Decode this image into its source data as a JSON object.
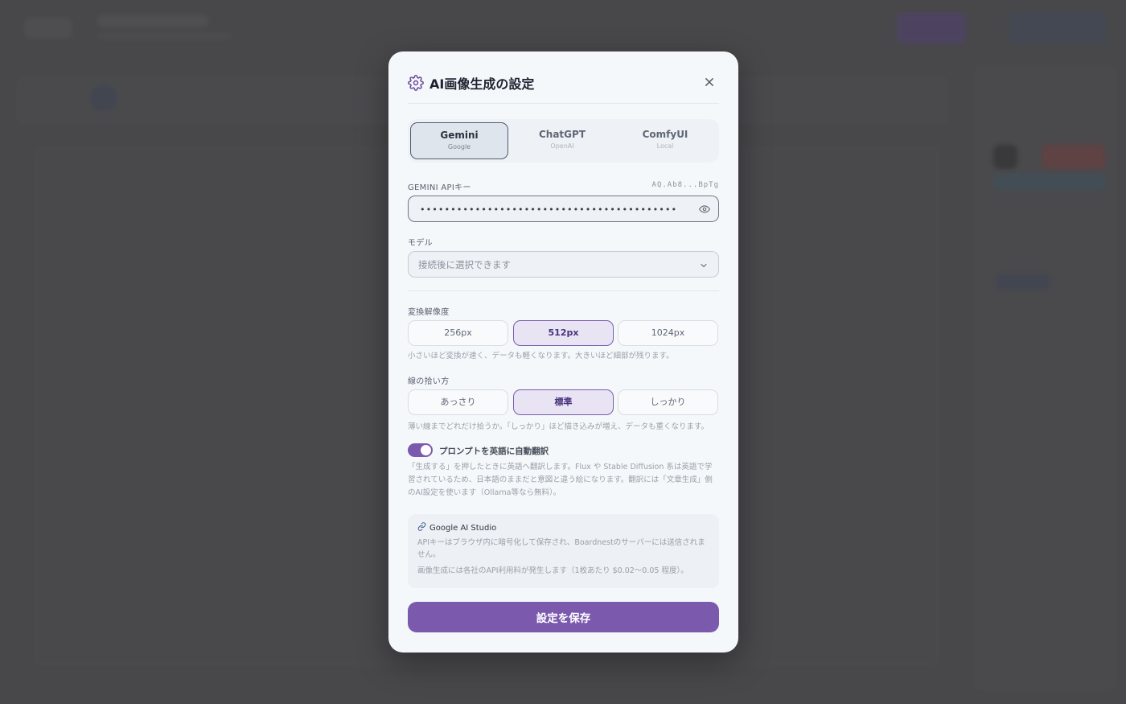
{
  "modal": {
    "title": "AI画像生成の設定",
    "providers": [
      {
        "name": "Gemini",
        "sub": "Google",
        "active": true
      },
      {
        "name": "ChatGPT",
        "sub": "OpenAI",
        "active": false
      },
      {
        "name": "ComfyUI",
        "sub": "Local",
        "active": false
      }
    ],
    "api_key": {
      "label": "GEMINI APIキー",
      "masked_preview": "AQ.Ab8...BpTg",
      "value": "•••••••••••••••••••••••••••••••••••••••••••••"
    },
    "model": {
      "label": "モデル",
      "placeholder": "接続後に選択できます"
    },
    "resolution": {
      "label": "変換解像度",
      "options": [
        "256px",
        "512px",
        "1024px"
      ],
      "selected": "512px",
      "help": "小さいほど変換が速く、データも軽くなります。大きいほど細部が残ります。"
    },
    "line_pickup": {
      "label": "線の拾い方",
      "options": [
        "あっさり",
        "標準",
        "しっかり"
      ],
      "selected": "標準",
      "help": "薄い線までどれだけ拾うか。「しっかり」ほど描き込みが増え、データも重くなります。"
    },
    "translate": {
      "label": "プロンプトを英語に自動翻訳",
      "enabled": true,
      "help": "「生成する」を押したときに英語へ翻訳します。Flux や Stable Diffusion 系は英語で学習されているため、日本語のままだと意図と違う絵になります。翻訳には「文章生成」側のAI設定を使います（Ollama等なら無料）。"
    },
    "info": {
      "link": "Google AI Studio",
      "note1": "APIキーはブラウザ内に暗号化して保存され、Boardnestのサーバーには送信されません。",
      "note2": "画像生成には各社のAPI利用料が発生します（1枚あたり $0.02〜0.05 程度）。"
    },
    "save_label": "設定を保存"
  },
  "colors": {
    "accent": "#7b5aae",
    "accent_light": "#e8e4f3",
    "backdrop": "#4a4a4c"
  }
}
